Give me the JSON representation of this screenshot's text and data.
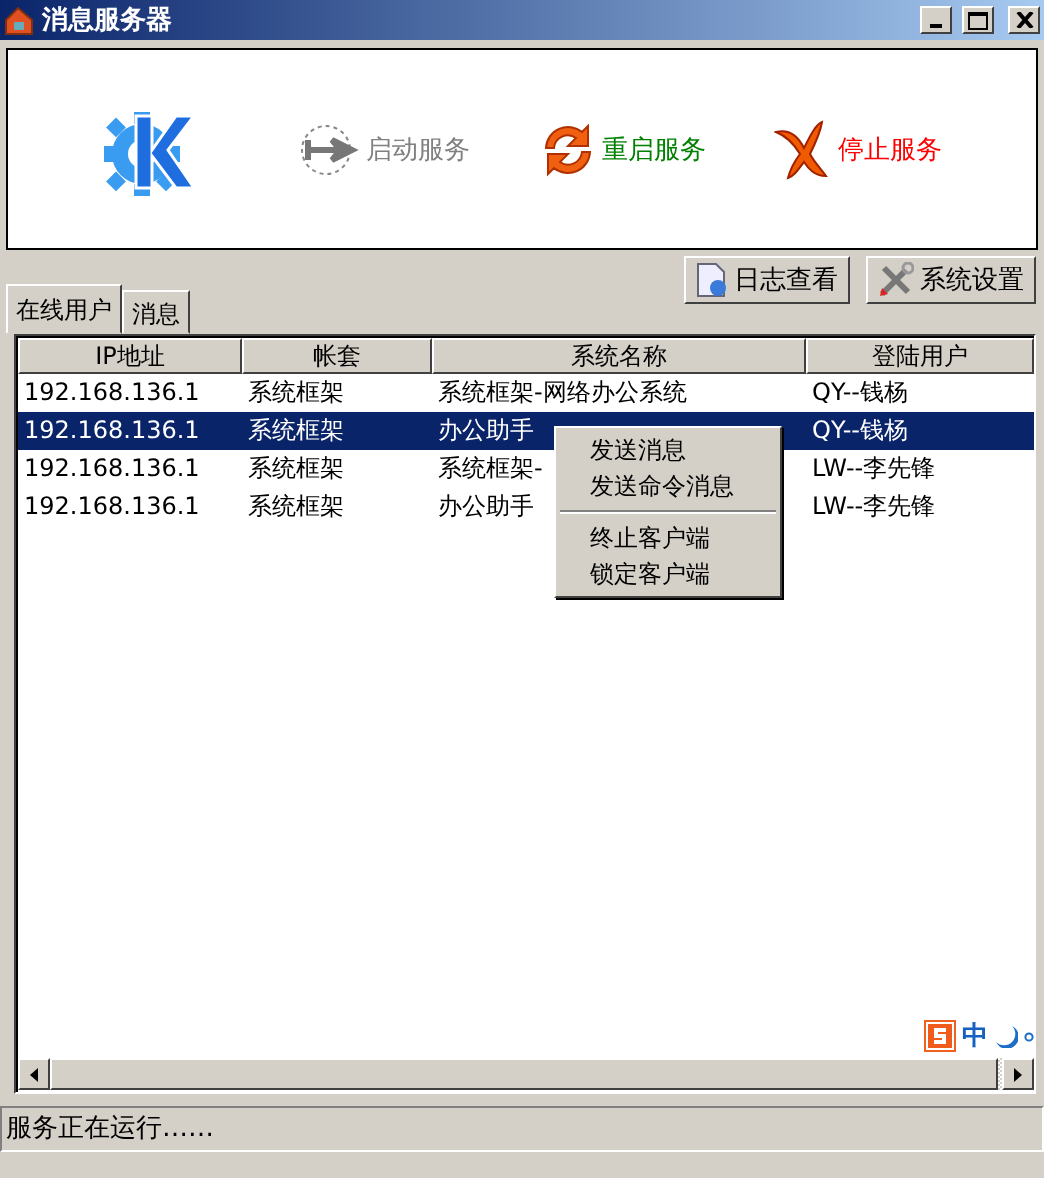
{
  "window": {
    "title": "消息服务器"
  },
  "toolbar": [
    {
      "label": "启动服务",
      "kind": "start",
      "disabled": true
    },
    {
      "label": "重启服务",
      "kind": "restart",
      "disabled": false
    },
    {
      "label": "停止服务",
      "kind": "stop",
      "disabled": false
    }
  ],
  "tabs": [
    {
      "label": "在线用户",
      "selected": true
    },
    {
      "label": "消息",
      "selected": false
    }
  ],
  "actions": [
    {
      "label": "日志查看",
      "kind": "log"
    },
    {
      "label": "系统设置",
      "kind": "settings"
    }
  ],
  "table": {
    "columns": [
      "IP地址",
      "帐套",
      "系统名称",
      "登陆用户"
    ],
    "rows": [
      {
        "cells": [
          "192.168.136.1",
          "系统框架",
          "系统框架-网络办公系统",
          "QY--钱杨"
        ],
        "selected": false
      },
      {
        "cells": [
          "192.168.136.1",
          "系统框架",
          "办公助手",
          "QY--钱杨"
        ],
        "selected": true
      },
      {
        "cells": [
          "192.168.136.1",
          "系统框架",
          "系统框架-",
          "LW--李先锋"
        ],
        "selected": false
      },
      {
        "cells": [
          "192.168.136.1",
          "系统框架",
          "办公助手",
          "LW--李先锋"
        ],
        "selected": false
      }
    ]
  },
  "context_menu": {
    "items": [
      {
        "kind": "item",
        "label": "发送消息"
      },
      {
        "kind": "item",
        "label": "发送命令消息"
      },
      {
        "kind": "separator"
      },
      {
        "kind": "item",
        "label": "终止客户端"
      },
      {
        "kind": "item",
        "label": "锁定客户端"
      }
    ]
  },
  "ime": {
    "label": "中"
  },
  "status_bar": {
    "text": "服务正在运行……"
  }
}
